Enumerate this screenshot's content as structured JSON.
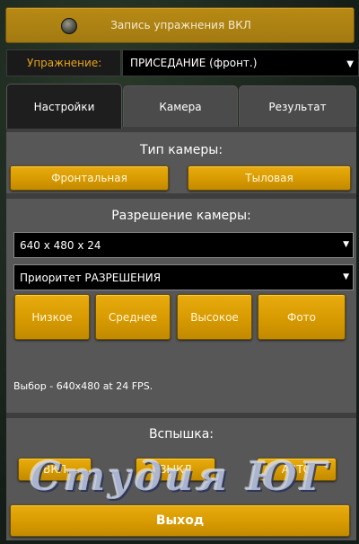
{
  "record_button": {
    "label": "Запись упражнения ВКЛ"
  },
  "exercise": {
    "label": "Упражнение:",
    "value": "ПРИСЕДАНИЕ  (фронт.)"
  },
  "tabs": [
    {
      "label": "Настройки",
      "active": true
    },
    {
      "label": "Камера",
      "active": false
    },
    {
      "label": "Результат",
      "active": false
    }
  ],
  "camera_type": {
    "title": "Тип камеры:",
    "options": [
      "Фронтальная",
      "Тыловая"
    ]
  },
  "resolution": {
    "title": "Разрешение камеры:",
    "resolution_value": "640 x 480 x 24",
    "priority_value": "Приоритет РАЗРЕШЕНИЯ",
    "quality_buttons": [
      "Низкое",
      "Среднее",
      "Высокое",
      "Фото"
    ],
    "status": "Выбор - 640x480 at 24 FPS."
  },
  "flash": {
    "title": "Вспышка:",
    "options": [
      "ВКЛ",
      "ВЫКЛ",
      "АВТО"
    ]
  },
  "watermark": "Студия ЮГ",
  "exit_button": {
    "label": "Выход"
  },
  "colors": {
    "accent": "#d99c00",
    "label": "#e7a316",
    "panel": "#575757"
  }
}
